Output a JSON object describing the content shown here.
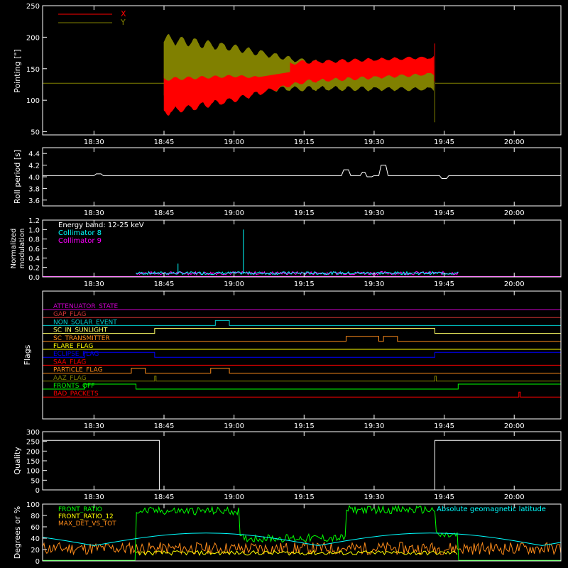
{
  "time_ticks": [
    "18:30",
    "18:45",
    "19:00",
    "19:15",
    "19:30",
    "19:45",
    "20:00"
  ],
  "chart_data": [
    {
      "id": "pointing",
      "type": "line",
      "ylabel": "Pointing [\"]",
      "ylim": [
        45,
        250
      ],
      "yticks": [
        50,
        100,
        150,
        200,
        250
      ],
      "legend": [
        {
          "name": "X",
          "color": "#ff0000"
        },
        {
          "name": "Y",
          "color": "#808000"
        }
      ],
      "baseline": 127,
      "segments": [
        {
          "t": "18:45",
          "x_mean": 113,
          "x_amp": 38,
          "y_mean": 150,
          "y_amp": 55
        },
        {
          "t": "19:00",
          "x_mean": 125,
          "x_amp": 28,
          "y_mean": 150,
          "y_amp": 38
        },
        {
          "t": "19:15",
          "x_mean": 145,
          "x_amp": 18,
          "y_mean": 140,
          "y_amp": 25
        },
        {
          "t": "19:43",
          "x_mean": 155,
          "x_amp": 15,
          "y_mean": 135,
          "y_amp": 20
        }
      ],
      "active_range": [
        "18:45",
        "19:43"
      ]
    },
    {
      "id": "roll",
      "type": "line",
      "ylabel": "Roll period [s]",
      "ylim": [
        3.5,
        4.5
      ],
      "yticks": [
        3.6,
        3.8,
        4.0,
        4.2,
        4.4
      ],
      "baseline": 4.02,
      "spikes": [
        {
          "t": "18:31",
          "v": 4.05
        },
        {
          "t": "19:24",
          "v": 4.12
        },
        {
          "t": "19:28",
          "v": 4.08
        },
        {
          "t": "19:29",
          "v": 4.0
        },
        {
          "t": "19:32",
          "v": 4.2
        },
        {
          "t": "19:45",
          "v": 3.97
        }
      ]
    },
    {
      "id": "modulation",
      "type": "line",
      "ylabel": [
        "Normalized",
        "modulation"
      ],
      "ylim": [
        0,
        1.2
      ],
      "yticks": [
        0.0,
        0.2,
        0.4,
        0.6,
        0.8,
        1.0,
        1.2
      ],
      "legend": [
        {
          "name": "Energy band: 12-25 keV",
          "color": "#ffffff"
        },
        {
          "name": "Collimator 8",
          "color": "#00ffff"
        },
        {
          "name": "Collimator 9",
          "color": "#ff00ff"
        }
      ],
      "active_range": [
        "18:39",
        "19:48"
      ],
      "typical": 0.08,
      "spikes": [
        {
          "t": "18:48",
          "v": 0.28,
          "series": "Collimator 8"
        },
        {
          "t": "19:02",
          "v": 1.0,
          "series": "Collimator 8"
        }
      ]
    },
    {
      "id": "flags",
      "type": "line",
      "ylabel": "Flags",
      "rows": [
        {
          "name": "ATTENUATOR_STATE",
          "color": "#cc00cc",
          "on": []
        },
        {
          "name": "GAP_FLAG",
          "color": "#cc3333",
          "on": []
        },
        {
          "name": "NON_SOLAR_EVENT",
          "color": "#00cccc",
          "on": [
            [
              "18:56",
              "18:59"
            ]
          ]
        },
        {
          "name": "SC_IN_SUNLIGHT",
          "color": "#ffff66",
          "on": [
            [
              "18:43",
              "19:43"
            ]
          ]
        },
        {
          "name": "SC_TRANSMITTER",
          "color": "#ff8c1a",
          "on": [
            [
              "19:24",
              "19:31"
            ],
            [
              "19:32",
              "19:35"
            ]
          ]
        },
        {
          "name": "FLARE_FLAG",
          "color": "#ffff00",
          "on": []
        },
        {
          "name": "ECLIPSE_FLAG",
          "color": "#0000ff",
          "on": [
            [
              "18:28",
              "18:43"
            ],
            [
              "19:43",
              "20:10"
            ]
          ]
        },
        {
          "name": "SAA_FLAG",
          "color": "#ff0000",
          "on": []
        },
        {
          "name": "PARTICLE_FLAG",
          "color": "#ff8c1a",
          "on": [
            [
              "18:38",
              "18:41"
            ],
            [
              "18:55",
              "18:59"
            ]
          ]
        },
        {
          "name": "AAZ_FLAG",
          "color": "#808000",
          "on": [
            [
              "18:43",
              "18:43"
            ],
            [
              "19:43",
              "19:43"
            ]
          ]
        },
        {
          "name": "FRONTS_OFF",
          "color": "#00ff00",
          "on": [
            [
              "18:28",
              "18:39"
            ],
            [
              "19:48",
              "20:10"
            ]
          ]
        },
        {
          "name": "BAD_PACKETS",
          "color": "#ff0000",
          "on": [
            [
              "20:01",
              "20:01"
            ]
          ]
        }
      ]
    },
    {
      "id": "quality",
      "type": "line",
      "ylabel": "Quality",
      "ylim": [
        0,
        300
      ],
      "yticks": [
        0,
        50,
        100,
        150,
        200,
        250,
        300
      ],
      "high": 255,
      "low": 0,
      "high_ranges": [
        [
          "18:28",
          "18:44"
        ],
        [
          "19:43",
          "20:10"
        ]
      ]
    },
    {
      "id": "fronts",
      "type": "line",
      "ylabel": "Degrees or %",
      "ylim": [
        0,
        100
      ],
      "yticks": [
        0,
        20,
        40,
        60,
        80,
        100
      ],
      "legend": [
        {
          "name": "FRONT_RATIO",
          "color": "#00ff00"
        },
        {
          "name": "FRONT_RATIO_12",
          "color": "#ffff00"
        },
        {
          "name": "MAX_DET_VS_TOT",
          "color": "#ff8c1a"
        }
      ],
      "annotation": {
        "text": "Absolute geomagnetic latitude",
        "color": "#00ffff"
      },
      "front_ratio_levels": [
        {
          "t": "18:39",
          "v": 88
        },
        {
          "t": "19:01",
          "v": 40
        },
        {
          "t": "19:24",
          "v": 90
        },
        {
          "t": "19:43",
          "v": 45
        },
        {
          "t": "19:48",
          "v": 0
        }
      ]
    }
  ],
  "colors": {
    "axes": "#ffffff",
    "background": "#000000"
  }
}
